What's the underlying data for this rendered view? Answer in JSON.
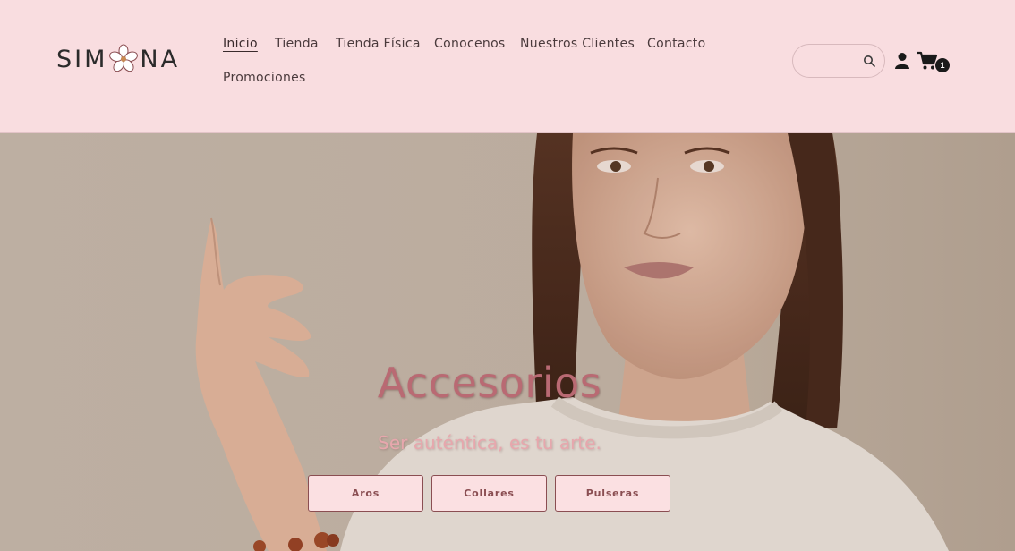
{
  "header": {
    "logo_text_left": "SIM",
    "logo_text_right": "NA",
    "nav": [
      {
        "label": "Inicio",
        "active": true
      },
      {
        "label": "Tienda"
      },
      {
        "label": "Tienda Física"
      },
      {
        "label": "Conocenos"
      },
      {
        "label": "Nuestros Clientes"
      },
      {
        "label": "Contacto"
      },
      {
        "label": "Promociones"
      }
    ],
    "search": {
      "value": "",
      "placeholder": "",
      "icon": "search-icon"
    },
    "account_icon": "user-icon",
    "cart": {
      "icon": "cart-icon",
      "count": "1"
    }
  },
  "hero": {
    "title": "Accesorios",
    "subtitle": "Ser auténtica, es tu arte.",
    "buttons": [
      {
        "label": "Aros"
      },
      {
        "label": "Collares"
      },
      {
        "label": "Pulseras"
      }
    ]
  },
  "colors": {
    "header_bg": "#f9dde0",
    "accent": "#8a4e52",
    "title": "#b96a73"
  }
}
